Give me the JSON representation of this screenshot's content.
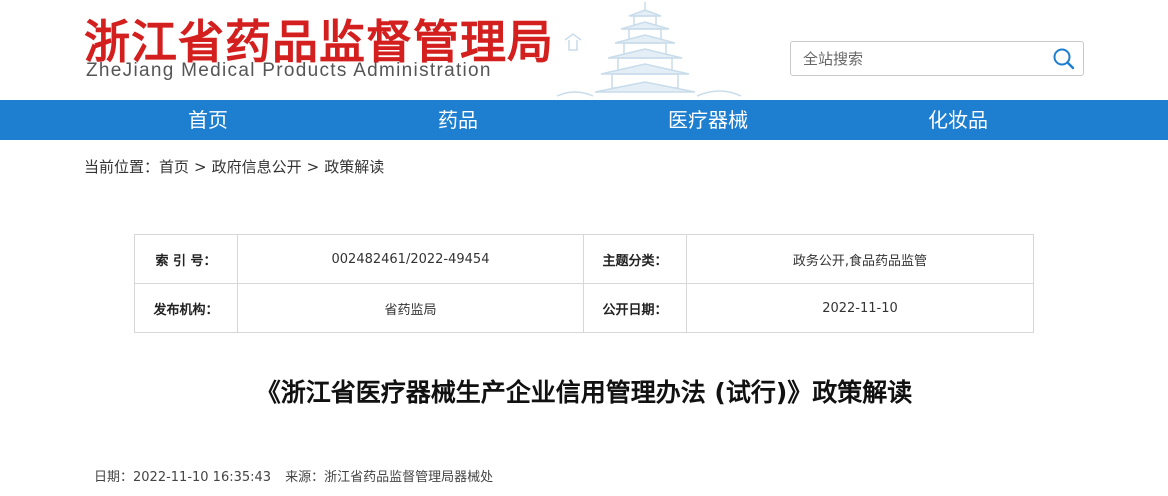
{
  "header": {
    "title": "浙江省药品监督管理局",
    "subtitle": "ZheJiang Medical Products Administration"
  },
  "search": {
    "placeholder": "全站搜索"
  },
  "nav": {
    "items": [
      {
        "label": "首页"
      },
      {
        "label": "药品"
      },
      {
        "label": "医疗器械"
      },
      {
        "label": "化妆品"
      }
    ]
  },
  "breadcrumb": {
    "prefix": "当前位置：",
    "items": [
      "首页",
      "政府信息公开",
      "政策解读"
    ],
    "separator": ">"
  },
  "meta": {
    "index_label": "索 引 号：",
    "index_value": "002482461/2022-49454",
    "topic_label": "主题分类：",
    "topic_value": "政务公开,食品药品监管",
    "publisher_label": "发布机构：",
    "publisher_value": "省药监局",
    "date_label": "公开日期：",
    "date_value": "2022-11-10"
  },
  "article": {
    "title": "《浙江省医疗器械生产企业信用管理办法 (试行)》政策解读",
    "date_text": "日期：2022-11-10 16:35:43",
    "source_text": "来源：浙江省药品监督管理局器械处"
  },
  "colors": {
    "brand_red": "#d41f1f",
    "nav_blue": "#1e7ed0"
  },
  "icons": {
    "search": "search-icon",
    "pagoda": "pagoda-illustration"
  }
}
